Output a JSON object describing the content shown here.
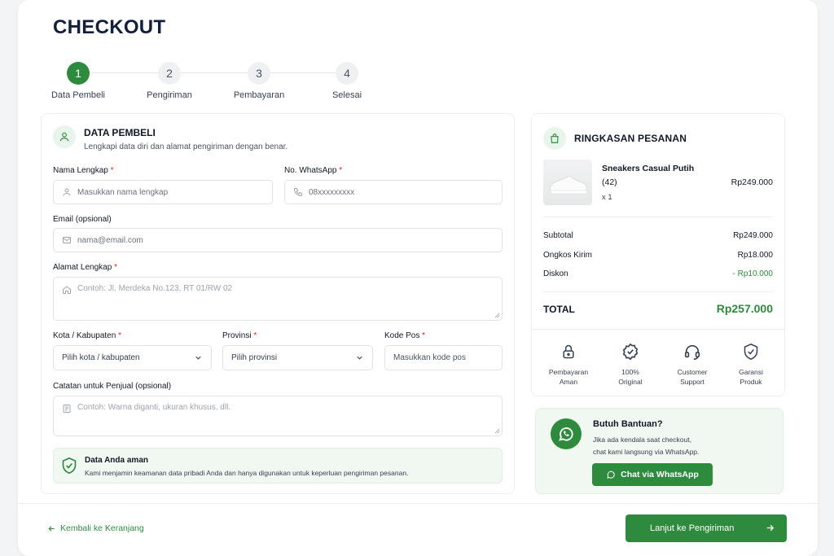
{
  "page": {
    "title": "CHECKOUT"
  },
  "stepper": {
    "steps": [
      {
        "number": "1",
        "label": "Data Pembeli",
        "active": true
      },
      {
        "number": "2",
        "label": "Pengiriman",
        "active": false
      },
      {
        "number": "3",
        "label": "Pembayaran",
        "active": false
      },
      {
        "number": "4",
        "label": "Selesai",
        "active": false
      }
    ]
  },
  "form": {
    "section_title": "DATA PEMBELI",
    "section_subtitle": "Lengkapi data diri dan alamat pengiriman dengan benar.",
    "required_mark": "*",
    "name": {
      "label": "Nama Lengkap",
      "placeholder": "Masukkan nama lengkap"
    },
    "whatsapp": {
      "label": "No. WhatsApp",
      "placeholder": "08xxxxxxxxx"
    },
    "email": {
      "label": "Email (opsional)",
      "placeholder": "nama@email.com"
    },
    "address": {
      "label": "Alamat Lengkap",
      "placeholder": "Contoh: Jl. Merdeka No.123, RT 01/RW 02"
    },
    "city": {
      "label": "Kota / Kabupaten",
      "value": "Pilih kota / kabupaten"
    },
    "province": {
      "label": "Provinsi",
      "value": "Pilih provinsi"
    },
    "postal": {
      "label": "Kode Pos",
      "placeholder": "Masukkan kode pos"
    },
    "notes": {
      "label": "Catatan untuk Penjual (opsional)",
      "placeholder": "Contoh: Warna diganti, ukuran khusus, dll."
    },
    "notice": {
      "title": "Data Anda aman",
      "text": "Kami menjamin keamanan data pribadi Anda dan hanya digunakan untuk keperluan pengiriman pesanan."
    }
  },
  "summary": {
    "title": "RINGKASAN PESANAN",
    "product": {
      "name": "Sneakers Casual Putih",
      "size": "(42)",
      "qty": "x 1",
      "price": "Rp249.000"
    },
    "rows": [
      {
        "label": "Subtotal",
        "value": "Rp249.000"
      },
      {
        "label": "Ongkos Kirim",
        "value": "Rp18.000"
      },
      {
        "label": "Diskon",
        "value": "- Rp10.000"
      }
    ],
    "total_label": "TOTAL",
    "total_value": "Rp257.000",
    "badges": [
      {
        "line1": "Pembayaran",
        "line2": "Aman",
        "icon": "lock-icon"
      },
      {
        "line1": "100%",
        "line2": "Original",
        "icon": "verified-badge-icon"
      },
      {
        "line1": "Customer",
        "line2": "Support",
        "icon": "headset-icon"
      },
      {
        "line1": "Garansi",
        "line2": "Produk",
        "icon": "shield-check-icon"
      }
    ]
  },
  "help": {
    "title": "Butuh Bantuan?",
    "line1": "Jika ada kendala saat checkout,",
    "line2": "chat kami langsung via WhatsApp.",
    "button": "Chat via WhatsApp"
  },
  "footer": {
    "back": "Kembali ke Keranjang",
    "next": "Lanjut ke Pengiriman"
  },
  "colors": {
    "accent": "#2e8b3e",
    "accent_light": "#f1f8f2",
    "required": "#dc2626"
  }
}
